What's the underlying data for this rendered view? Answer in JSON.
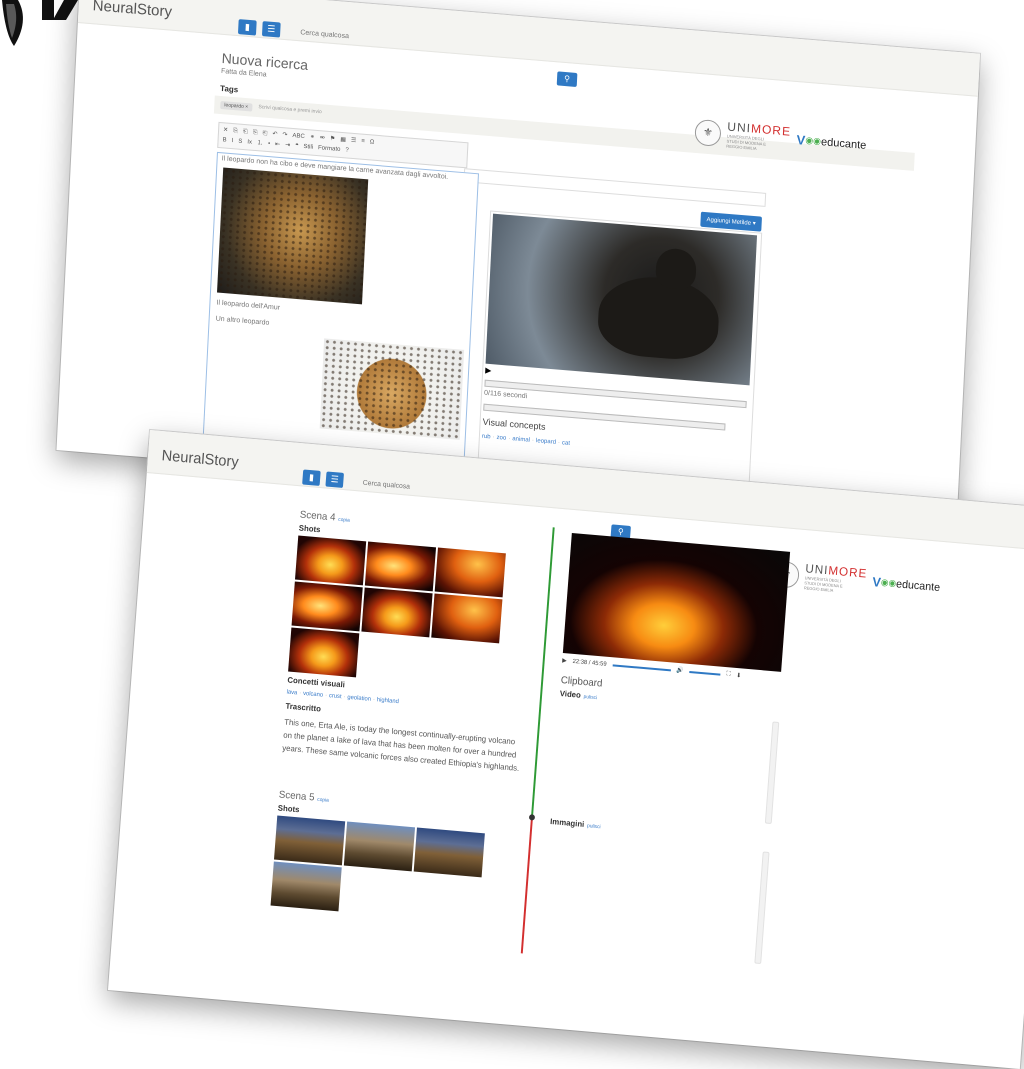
{
  "brand": "NeuralStory",
  "search": {
    "placeholder": "Cerca qualcosa"
  },
  "icons": {
    "doc": "document-icon",
    "list": "list-icon",
    "search": "search-icon"
  },
  "logos": {
    "uni_prefix": "UNI",
    "uni_accent": "MORE",
    "uni_sub": "UNIVERSITÀ DEGLI STUDI DI MODENA E REGGIO EMILIA",
    "edu_v": "V",
    "edu_text": "educante"
  },
  "colors": {
    "accent": "#2f79c4",
    "timeline_top": "#2e9a35",
    "timeline_bottom": "#d32f2f"
  },
  "window1": {
    "title": "Nuova ricerca",
    "subtitle": "Fatta da Elena",
    "tags_label": "Tags",
    "tag_chip": "leopardo ×",
    "tag_placeholder": "Scrivi qualcosa e premi invio",
    "toolbar": {
      "row1": [
        "✕",
        "⎘",
        "⎗",
        "⎘",
        "⎗",
        "↶",
        "↷",
        "ABC",
        "⚭",
        "⚮",
        "⚑",
        "▦",
        "☰",
        "≡",
        "Ω"
      ],
      "row2": [
        "B",
        "I",
        "S",
        "Ix",
        "⒈",
        "•",
        "⇤",
        "⇥",
        "❝",
        "Stili",
        "Formato",
        "?"
      ]
    },
    "editor_text": "Il leopardo non ha cibo e deve mangiare la carne avanzata dagli avvoltoi.",
    "caption1": "Il leopardo dell'Amur",
    "caption2": "Un altro leopardo",
    "add_button": "Aggiungi Metilde ▾",
    "video_time": "0/116 secondi",
    "concepts_title": "Visual concepts",
    "concepts": [
      "rub",
      "zoo",
      "animal",
      "leopard",
      "cat"
    ]
  },
  "window2": {
    "scene4_title": "Scena 4",
    "copy_link": "copia",
    "shots_label": "Shots",
    "concepts_title": "Concetti visuali",
    "concepts": [
      "lava",
      "volcano",
      "crust",
      "geolation",
      "highland"
    ],
    "transcript_title": "Trascritto",
    "transcript": "This one, Erta Ale, is today the longest continually-erupting volcano on the planet a lake of lava that has been molten for over a hundred years. These same volcanic forces also created Ethiopia's highlands.",
    "scene5_title": "Scena 5",
    "video_time": "22:38 / 45:59",
    "clipboard": "Clipboard",
    "video_label": "Video",
    "images_label": "Immagini",
    "clear_link": "pulisci"
  }
}
